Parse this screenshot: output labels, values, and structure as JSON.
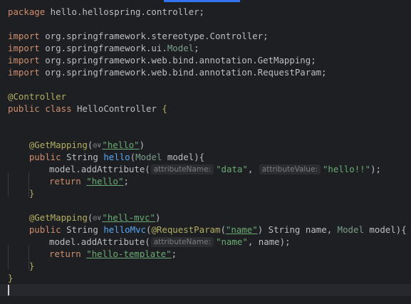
{
  "code": {
    "l1_kw": "package",
    "l1_pkg": " hello.hellospring.controller;",
    "import_kw": "import",
    "imp1_pre": " org.springframework.stereotype.",
    "imp1_cls": "Controller",
    "imp1_end": ";",
    "imp2_pre": " org.springframework.ui.",
    "imp2_cls": "Model",
    "imp2_end": ";",
    "imp3_pre": " org.springframework.web.bind.annotation.",
    "imp3_cls": "GetMapping",
    "imp3_end": ";",
    "imp4_pre": " org.springframework.web.bind.annotation.",
    "imp4_cls": "RequestParam",
    "imp4_end": ";",
    "ann_controller": "@Controller",
    "public_kw": "public",
    "class_kw": "class",
    "class_name": "HelloController",
    "brace_open": "{",
    "brace_close": "}",
    "ann_getmapping": "@GetMapping",
    "paren_open": "(",
    "paren_close": ")",
    "route_hello": "\"hello\"",
    "string_type": "String",
    "method_hello": "hello",
    "model_type": "Model",
    "model_param": "model",
    "sig_end": "){",
    "model_ref": "model",
    "add_attr": ".addAttribute(",
    "hint_attr_name": "attributeName:",
    "arg_data": "\"data\"",
    "comma": ",",
    "hint_attr_value": "attributeValue:",
    "arg_hello_excl": "\"hello!!\"",
    "call_end": ");",
    "return_kw": "return",
    "ret_hello": "\"hello\"",
    "semicolon": ";",
    "route_hello_mvc": "\"hell-mvc\"",
    "method_hello_mvc": "helloMvc",
    "ann_requestparam": "@RequestParam",
    "req_name": "\"name\"",
    "name_param": "name",
    "arg_name": "\"name\"",
    "name_ref": "name",
    "ret_hello_template": "\"hello-template\"",
    "globe_icon": "◎∨"
  }
}
